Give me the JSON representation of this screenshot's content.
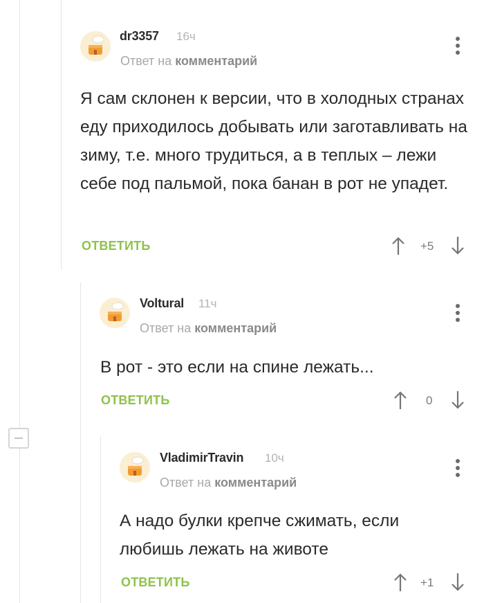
{
  "comments": [
    {
      "author": "dr3357",
      "time": "16ч",
      "reply_prefix": "Ответ на",
      "reply_link": "комментарий",
      "text": "Я сам склонен к версии, что в холодных странах еду приходилось добывать или заготавливать на зиму, т.е. много трудиться, а в теплых – лежи себе под пальмой, пока банан в рот не упадет.",
      "reply_label": "ОТВЕТИТЬ",
      "rating": "+5"
    },
    {
      "author": "Voltural",
      "time": "11ч",
      "reply_prefix": "Ответ на",
      "reply_link": "комментарий",
      "text": "В рот - это если на спине лежать...",
      "reply_label": "ОТВЕТИТЬ",
      "rating": "0"
    },
    {
      "author": "VladimirTravin",
      "time": "10ч",
      "reply_prefix": "Ответ на",
      "reply_link": "комментарий",
      "text": "А надо булки крепче сжимать, если любишь лежать на животе",
      "reply_label": "ОТВЕТИТЬ",
      "rating": "+1"
    }
  ],
  "icons": {
    "avatar": "default-avatar-icon",
    "menu": "more-vertical-icon",
    "upvote": "arrow-up-icon",
    "downvote": "arrow-down-icon",
    "collapse": "minus-icon"
  },
  "colors": {
    "accent": "#8ec24a",
    "thread_line": "#e4e4e4",
    "meta": "#a8a8a8"
  }
}
